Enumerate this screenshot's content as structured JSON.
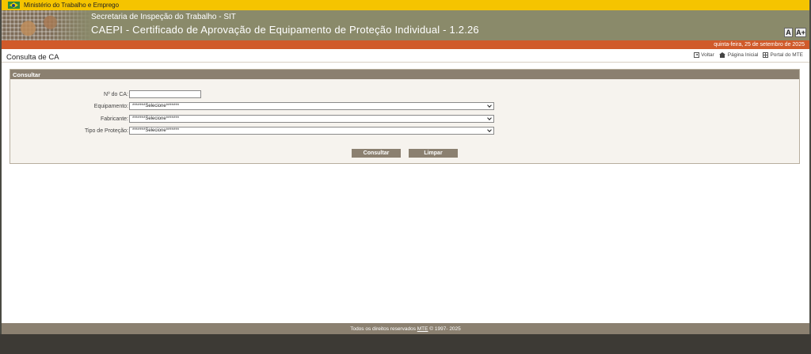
{
  "gov_bar": {
    "text": "Ministério do Trabalho e Emprego"
  },
  "header": {
    "subtitle": "Secretaria de Inspeção do Trabalho - SIT",
    "title": "CAEPI - Certificado de Aprovação de Equipamento de Proteção Individual - 1.2.26",
    "font_small": "A",
    "font_large": "A+"
  },
  "date_bar": {
    "date": "quinta-feira, 25 de setembro de 2025"
  },
  "page": {
    "title": "Consulta de CA",
    "nav": {
      "back": "Voltar",
      "home": "Página Inicial",
      "portal": "Portal do MTE"
    }
  },
  "panel": {
    "heading": "Consultar",
    "fields": {
      "ca_label": "Nº do CA:",
      "ca_value": "",
      "equipamento_label": "Equipamento:",
      "equipamento_value": "*******Selecione*******",
      "fabricante_label": "Fabricante:",
      "fabricante_value": "*******Selecione*******",
      "tipo_label": "Tipo de Proteção:",
      "tipo_value": "*******Selecione*******"
    },
    "buttons": {
      "consultar": "Consultar",
      "limpar": "Limpar"
    }
  },
  "footer": {
    "prefix": "Todos os direitos reservados ",
    "org": "MTE",
    "suffix": " © 1997- 2025"
  },
  "colors": {
    "gov_yellow": "#f5c400",
    "banner": "#8a8a6a",
    "accent_orange": "#d05a2a",
    "panel_brown": "#8b8070"
  }
}
